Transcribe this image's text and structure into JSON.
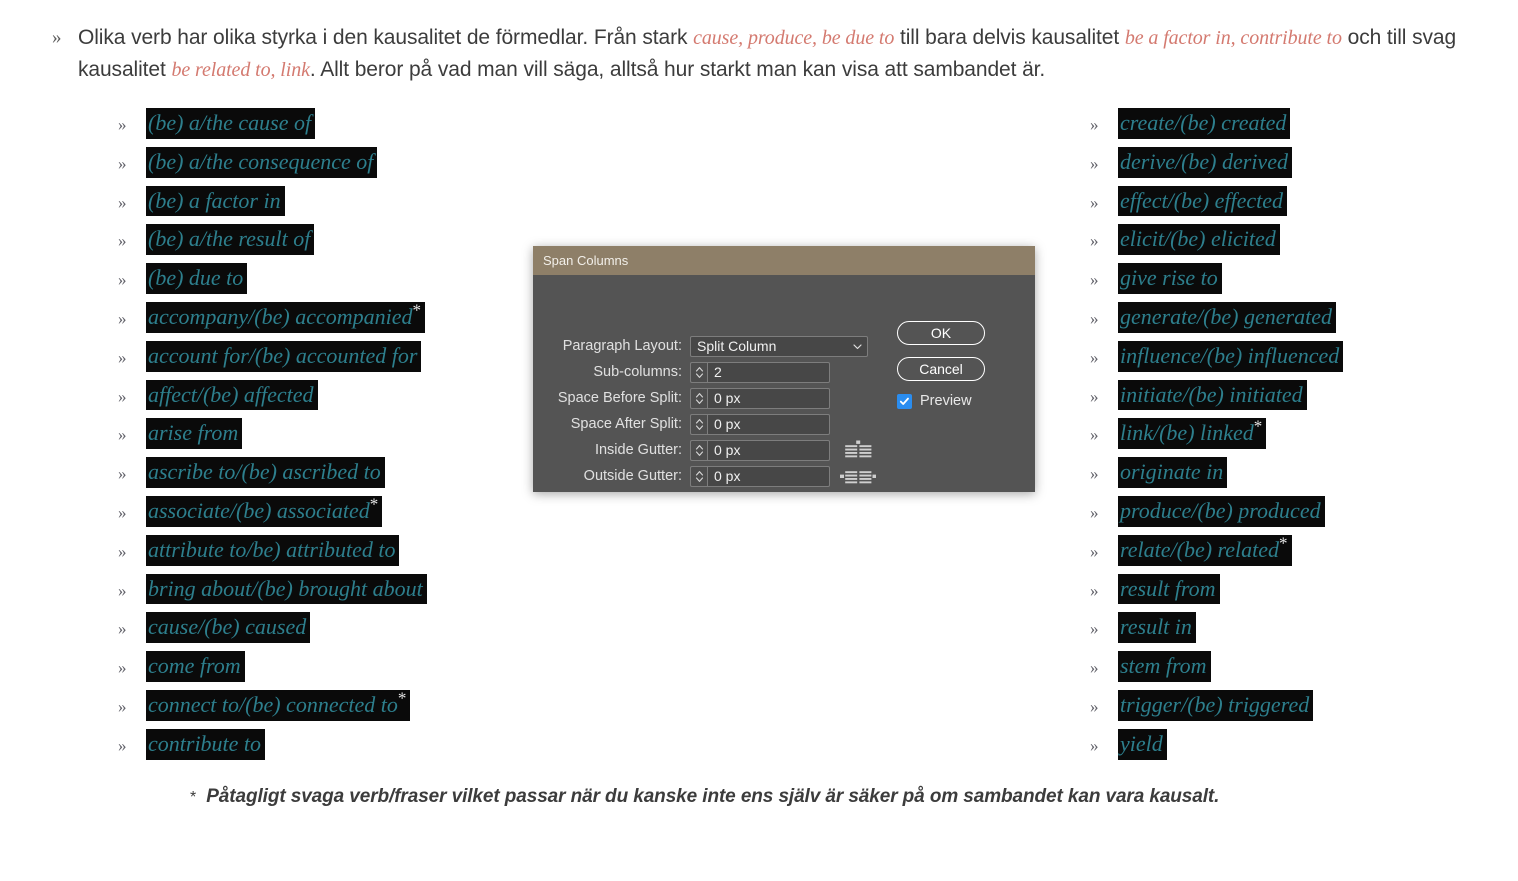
{
  "intro": {
    "bullet": "»",
    "segments": [
      {
        "text": "Olika verb har olika styrka i den kausalitet de förmedlar. Från stark ",
        "accent": false
      },
      {
        "text": "cause, produce, be due to",
        "accent": true
      },
      {
        "text": " till bara delvis kausalitet ",
        "accent": false
      },
      {
        "text": "be a factor in, contribute to",
        "accent": true
      },
      {
        "text": " och till svag kausalitet ",
        "accent": false
      },
      {
        "text": "be related to, link",
        "accent": true
      },
      {
        "text": ". Allt beror på vad man vill säga, alltså hur starkt man kan visa att sambandet är.",
        "accent": false
      }
    ]
  },
  "verb_bullet": "»",
  "left_column": [
    {
      "text": "(be) a/the cause of",
      "star": false
    },
    {
      "text": "(be) a/the consequence of",
      "star": false
    },
    {
      "text": "(be) a factor in",
      "star": false
    },
    {
      "text": "(be) a/the result of",
      "star": false
    },
    {
      "text": "(be) due to",
      "star": false
    },
    {
      "text": "accompany/(be) accompanied",
      "star": true
    },
    {
      "text": "account for/(be) accounted for",
      "star": false
    },
    {
      "text": "affect/(be) affected",
      "star": false
    },
    {
      "text": "arise from",
      "star": false
    },
    {
      "text": "ascribe to/(be) ascribed to",
      "star": false
    },
    {
      "text": "associate/(be) associated",
      "star": true
    },
    {
      "text": "attribute to/be) attributed to",
      "star": false
    },
    {
      "text": "bring about/(be) brought about",
      "star": false
    },
    {
      "text": "cause/(be) caused",
      "star": false
    },
    {
      "text": "come from",
      "star": false
    },
    {
      "text": "connect to/(be) connected to",
      "star": true
    },
    {
      "text": "contribute to",
      "star": false
    }
  ],
  "right_column": [
    {
      "text": "create/(be) created",
      "star": false
    },
    {
      "text": "derive/(be) derived",
      "star": false
    },
    {
      "text": "effect/(be) effected",
      "star": false
    },
    {
      "text": "elicit/(be) elicited",
      "star": false
    },
    {
      "text": "give rise to",
      "star": false
    },
    {
      "text": "generate/(be) generated",
      "star": false
    },
    {
      "text": "influence/(be) influenced",
      "star": false
    },
    {
      "text": "initiate/(be) initiated",
      "star": false
    },
    {
      "text": "link/(be) linked",
      "star": true
    },
    {
      "text": "originate in",
      "star": false
    },
    {
      "text": "produce/(be) produced",
      "star": false
    },
    {
      "text": "relate/(be) related",
      "star": true
    },
    {
      "text": "result from",
      "star": false
    },
    {
      "text": "result in",
      "star": false
    },
    {
      "text": "stem from",
      "star": false
    },
    {
      "text": "trigger/(be) triggered",
      "star": false
    },
    {
      "text": "yield",
      "star": false
    }
  ],
  "footnote": {
    "marker": "*",
    "text": "Påtagligt svaga verb/fraser vilket passar när du kanske inte ens själv är säker på om sambandet kan vara kausalt."
  },
  "dialog": {
    "title": "Span Columns",
    "fields": [
      {
        "label": "Paragraph Layout:",
        "type": "select",
        "value": "Split Column",
        "icon": null
      },
      {
        "label": "Sub-columns:",
        "type": "spin",
        "value": "2",
        "icon": null
      },
      {
        "label": "Space Before Split:",
        "type": "spin",
        "value": "0 px",
        "icon": null
      },
      {
        "label": "Space After Split:",
        "type": "spin",
        "value": "0 px",
        "icon": null
      },
      {
        "label": "Inside Gutter:",
        "type": "spin",
        "value": "0 px",
        "icon": "inside-gutter-icon"
      },
      {
        "label": "Outside Gutter:",
        "type": "spin",
        "value": "0 px",
        "icon": "outside-gutter-icon"
      }
    ],
    "ok_label": "OK",
    "cancel_label": "Cancel",
    "preview_label": "Preview",
    "preview_checked": true,
    "colors": {
      "titlebar": "#8e7f68",
      "body": "#545454",
      "checkbox_accent": "#2a8df0",
      "field_bg": "#474747"
    }
  },
  "colors": {
    "highlight_bg": "#0a0a0a",
    "verb_text": "#2d7f8d",
    "accent_text": "#d47a70",
    "body_text": "#3c3c3c"
  }
}
